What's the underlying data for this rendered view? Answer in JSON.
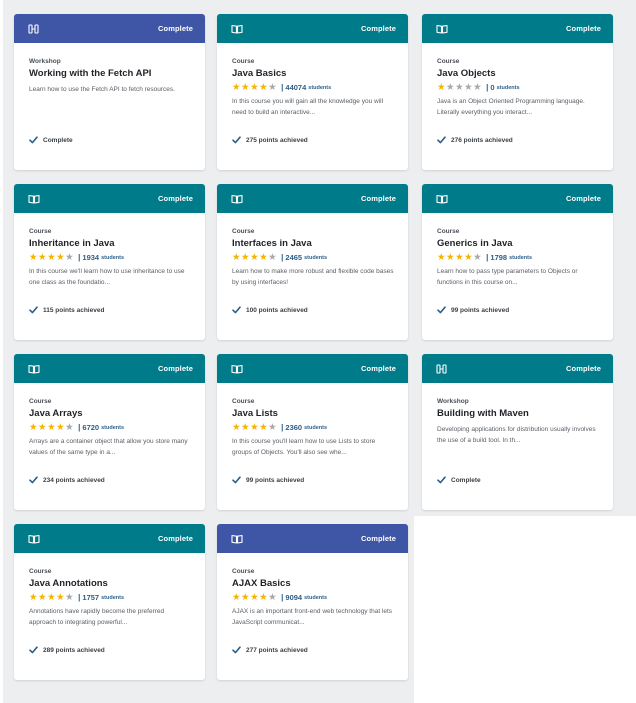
{
  "colors": {
    "teal": "#007b89",
    "blue": "#3f56a6",
    "star_on": "#f4b400",
    "star_off": "#a6a9ad",
    "link": "#2c5f8a"
  },
  "cards": [
    {
      "kind": "Workshop",
      "title": "Working with the Fetch API",
      "status": "Complete",
      "header": "blue",
      "icon": "workshop-icon",
      "rating": null,
      "students": null,
      "description": "Learn how to use the Fetch API to fetch resources.",
      "footer": "Complete"
    },
    {
      "kind": "Course",
      "title": "Java Basics",
      "status": "Complete",
      "header": "teal",
      "icon": "book-icon",
      "rating": 4,
      "count": "44074",
      "students": "students",
      "description": "In this course you will gain all the knowledge you will need to build an interactive...",
      "footer": "275 points achieved"
    },
    {
      "kind": "Course",
      "title": "Java Objects",
      "status": "Complete",
      "header": "teal",
      "icon": "book-icon",
      "rating": 1,
      "count": "0",
      "students": "students",
      "description": "Java is an Object Oriented Programming language. Literally everything you interact...",
      "footer": "276 points achieved"
    },
    {
      "kind": "Course",
      "title": "Inheritance in Java",
      "status": "Complete",
      "header": "teal",
      "icon": "book-icon",
      "rating": 4,
      "count": "1934",
      "students": "students",
      "description": "In this course we'll learn how to use inheritance to use one class as the foundatio...",
      "footer": "115 points achieved"
    },
    {
      "kind": "Course",
      "title": "Interfaces in Java",
      "status": "Complete",
      "header": "teal",
      "icon": "book-icon",
      "rating": 4,
      "count": "2465",
      "students": "students",
      "description": "Learn how to make more robust and flexible code bases by using interfaces!",
      "footer": "100 points achieved"
    },
    {
      "kind": "Course",
      "title": "Generics in Java",
      "status": "Complete",
      "header": "teal",
      "icon": "book-icon",
      "rating": 4,
      "count": "1798",
      "students": "students",
      "description": "Learn how to pass type parameters to Objects or functions in this course on...",
      "footer": "99 points achieved"
    },
    {
      "kind": "Course",
      "title": "Java Arrays",
      "status": "Complete",
      "header": "teal",
      "icon": "book-icon",
      "rating": 4,
      "count": "6720",
      "students": "students",
      "description": "Arrays are a container object that allow you store many values of the same type in a...",
      "footer": "234 points achieved"
    },
    {
      "kind": "Course",
      "title": "Java Lists",
      "status": "Complete",
      "header": "teal",
      "icon": "book-icon",
      "rating": 4,
      "count": "2360",
      "students": "students",
      "description": "In this course you'll learn how to use Lists to store groups of Objects. You'll also see whe...",
      "footer": "99 points achieved"
    },
    {
      "kind": "Workshop",
      "title": "Building with Maven",
      "status": "Complete",
      "header": "teal",
      "icon": "workshop-icon",
      "rating": null,
      "students": null,
      "description": "Developing applications for distribution usually involves the use of a build tool. In th...",
      "footer": "Complete"
    },
    {
      "kind": "Course",
      "title": "Java Annotations",
      "status": "Complete",
      "header": "teal",
      "icon": "book-icon",
      "rating": 4,
      "count": "1757",
      "students": "students",
      "description": "Annotations have rapidly become the preferred approach to integrating powerful...",
      "footer": "289 points achieved"
    },
    {
      "kind": "Course",
      "title": "AJAX Basics",
      "status": "Complete",
      "header": "blue",
      "icon": "book-icon",
      "rating": 4,
      "count": "9094",
      "students": "students",
      "description": "AJAX is an important front-end web technology that lets JavaScript communicat...",
      "footer": "277 points achieved"
    }
  ]
}
